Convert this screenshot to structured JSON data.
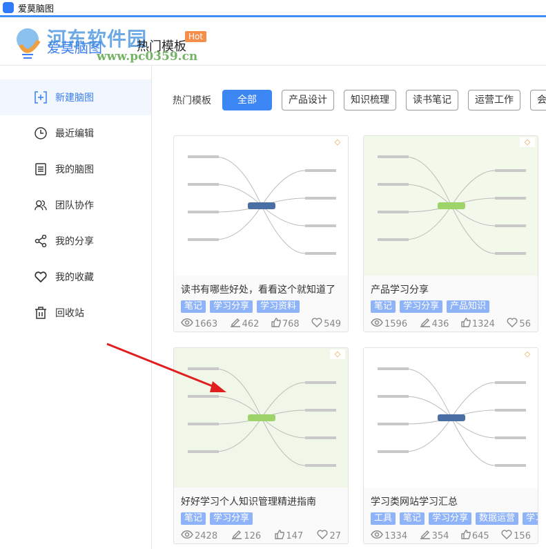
{
  "window": {
    "title": "爱莫脑图"
  },
  "header": {
    "logo_text": "爱莫脑图",
    "title": "热门模板",
    "hot_badge": "Hot"
  },
  "watermark": {
    "site_name": "河东软件园",
    "url": "www.pc0359.cn"
  },
  "sidebar": {
    "items": [
      {
        "label": "新建脑图",
        "icon": "new-map-icon"
      },
      {
        "label": "最近编辑",
        "icon": "clock-icon"
      },
      {
        "label": "我的脑图",
        "icon": "document-icon"
      },
      {
        "label": "团队协作",
        "icon": "team-icon"
      },
      {
        "label": "我的分享",
        "icon": "share-icon"
      },
      {
        "label": "我的收藏",
        "icon": "heart-icon"
      },
      {
        "label": "回收站",
        "icon": "trash-icon"
      }
    ]
  },
  "filters": {
    "label": "热门模板",
    "options": [
      "全部",
      "产品设计",
      "知识梳理",
      "读书笔记",
      "运营工作",
      "会议"
    ]
  },
  "cards": [
    {
      "title": "读书有哪些好处，看看这个就知道了",
      "tags": [
        "笔记",
        "学习分享",
        "学习资料"
      ],
      "views": "1663",
      "edits": "462",
      "likes": "768",
      "favs": "549",
      "bg": "#ffffff"
    },
    {
      "title": "产品学习分享",
      "tags": [
        "笔记",
        "学习分享",
        "产品知识"
      ],
      "views": "1596",
      "edits": "436",
      "likes": "1324",
      "favs": "56",
      "bg": "#f2f8ea"
    },
    {
      "title": "好好学习个人知识管理精进指南",
      "tags": [
        "笔记",
        "学习分享"
      ],
      "views": "2428",
      "edits": "126",
      "likes": "147",
      "favs": "27",
      "bg": "#f0f6e8"
    },
    {
      "title": "学习类网站学习汇总",
      "tags": [
        "工具",
        "笔记",
        "学习分享",
        "数据运营",
        "学习"
      ],
      "views": "1334",
      "edits": "354",
      "likes": "645",
      "favs": "156",
      "bg": "#ffffff"
    }
  ],
  "colors": {
    "accent": "#3d87f5",
    "tag": "#8fb3f9",
    "hot": "#f58d4b"
  }
}
